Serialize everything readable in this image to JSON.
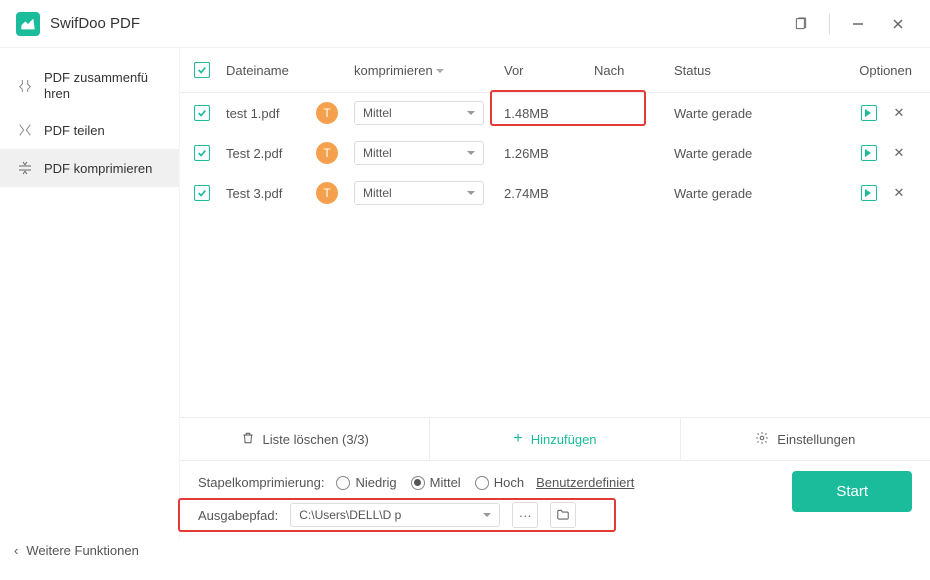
{
  "app": {
    "title": "SwifDoo PDF"
  },
  "sidebar": {
    "items": [
      {
        "label": "PDF zusammenfü\nhren"
      },
      {
        "label": "PDF teilen"
      },
      {
        "label": "PDF komprimieren"
      }
    ]
  },
  "table": {
    "headers": {
      "filename": "Dateiname",
      "compress": "komprimieren",
      "before": "Vor",
      "after": "Nach",
      "status": "Status",
      "options": "Optionen"
    },
    "rows": [
      {
        "filename": "test 1.pdf",
        "badge": "T",
        "compress": "Mittel",
        "before": "1.48MB",
        "after": "",
        "status": "Warte gerade"
      },
      {
        "filename": "Test 2.pdf",
        "badge": "T",
        "compress": "Mittel",
        "before": "1.26MB",
        "after": "",
        "status": "Warte gerade"
      },
      {
        "filename": "Test 3.pdf",
        "badge": "T",
        "compress": "Mittel",
        "before": "2.74MB",
        "after": "",
        "status": "Warte gerade"
      }
    ]
  },
  "actionbar": {
    "clear": "Liste löschen (3/3)",
    "add": "Hinzufügen",
    "settings": "Einstellungen"
  },
  "footer": {
    "batchLabel": "Stapelkomprimierung:",
    "radios": {
      "low": "Niedrig",
      "mid": "Mittel",
      "high": "Hoch"
    },
    "customLink": "Benutzerdefiniert",
    "outputLabel": "Ausgabepfad:",
    "outputPath": "C:\\Users\\DELL\\D           p",
    "start": "Start",
    "moreFunctions": "Weitere Funktionen"
  }
}
